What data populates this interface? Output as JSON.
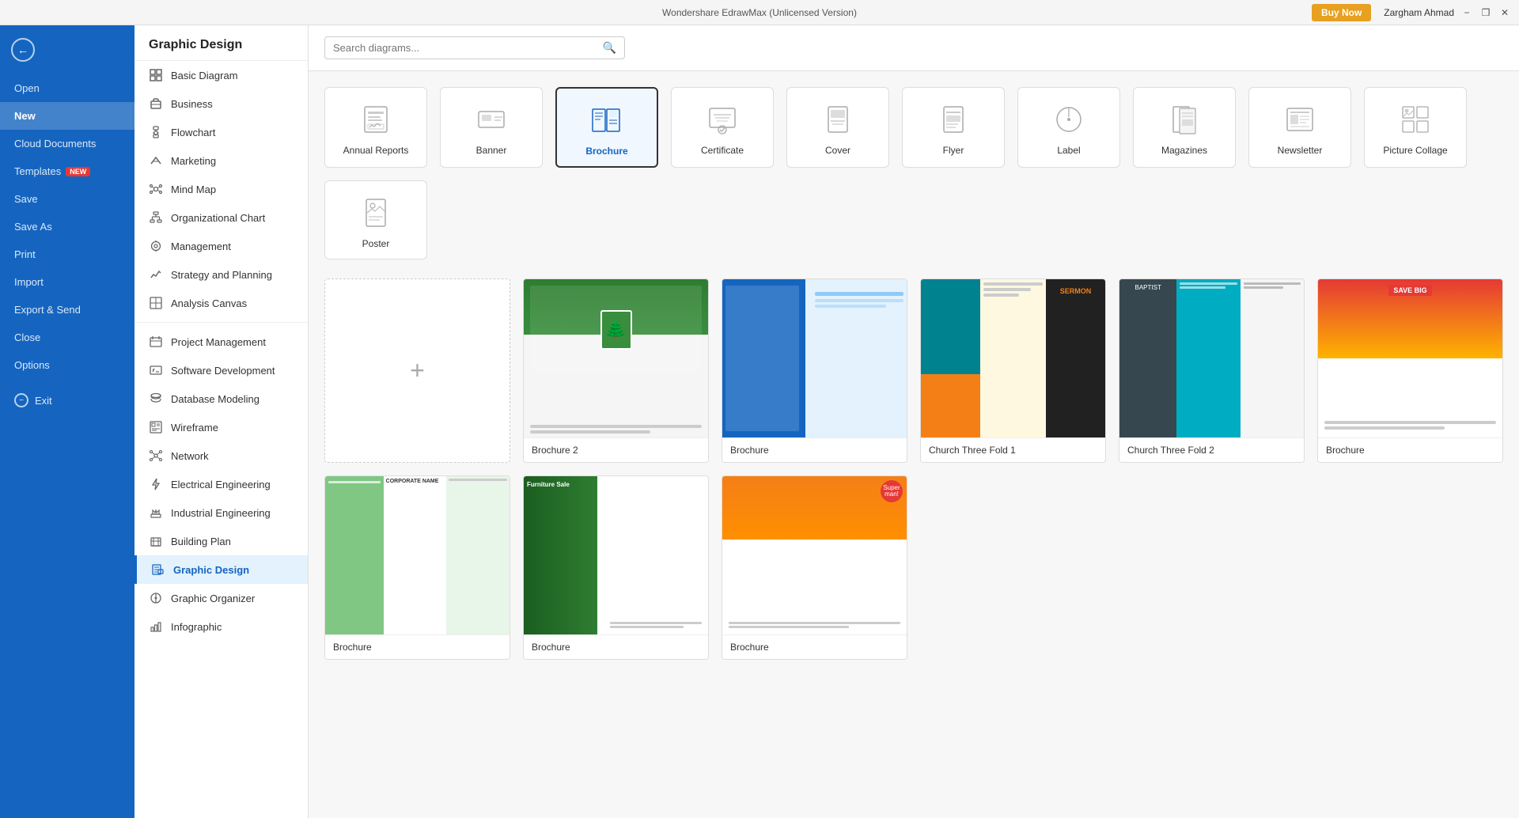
{
  "titlebar": {
    "title": "Wondershare EdrawMax (Unlicensed Version)",
    "controls": [
      "minimize",
      "restore",
      "close"
    ],
    "buy_now": "Buy Now",
    "user": "Zargham Ahmad"
  },
  "sidebar": {
    "back_label": "←",
    "items": [
      {
        "id": "open",
        "label": "Open",
        "active": false
      },
      {
        "id": "new",
        "label": "New",
        "active": true
      },
      {
        "id": "cloud",
        "label": "Cloud Documents",
        "active": false
      },
      {
        "id": "templates",
        "label": "Templates",
        "badge": "NEW",
        "active": false
      },
      {
        "id": "save",
        "label": "Save",
        "active": false
      },
      {
        "id": "save-as",
        "label": "Save As",
        "active": false
      },
      {
        "id": "print",
        "label": "Print",
        "active": false
      },
      {
        "id": "import",
        "label": "Import",
        "active": false
      },
      {
        "id": "export",
        "label": "Export & Send",
        "active": false
      },
      {
        "id": "close",
        "label": "Close",
        "active": false
      },
      {
        "id": "options",
        "label": "Options",
        "active": false
      },
      {
        "id": "exit",
        "label": "Exit",
        "active": false
      }
    ]
  },
  "categories_panel": {
    "header": "Graphic Design",
    "items": [
      {
        "id": "basic",
        "label": "Basic Diagram",
        "icon": "grid"
      },
      {
        "id": "business",
        "label": "Business",
        "icon": "briefcase"
      },
      {
        "id": "flowchart",
        "label": "Flowchart",
        "icon": "flow"
      },
      {
        "id": "marketing",
        "label": "Marketing",
        "icon": "marketing"
      },
      {
        "id": "mindmap",
        "label": "Mind Map",
        "icon": "mindmap"
      },
      {
        "id": "orgchart",
        "label": "Organizational Chart",
        "icon": "org"
      },
      {
        "id": "management",
        "label": "Management",
        "icon": "mgmt"
      },
      {
        "id": "strategy",
        "label": "Strategy and Planning",
        "icon": "strategy"
      },
      {
        "id": "analysis",
        "label": "Analysis Canvas",
        "icon": "analysis"
      },
      {
        "id": "project",
        "label": "Project Management",
        "icon": "project"
      },
      {
        "id": "software",
        "label": "Software Development",
        "icon": "software"
      },
      {
        "id": "database",
        "label": "Database Modeling",
        "icon": "database"
      },
      {
        "id": "wireframe",
        "label": "Wireframe",
        "icon": "wireframe"
      },
      {
        "id": "network",
        "label": "Network",
        "icon": "network"
      },
      {
        "id": "electrical",
        "label": "Electrical Engineering",
        "icon": "electrical"
      },
      {
        "id": "industrial",
        "label": "Industrial Engineering",
        "icon": "industrial"
      },
      {
        "id": "building",
        "label": "Building Plan",
        "icon": "building"
      },
      {
        "id": "graphic",
        "label": "Graphic Design",
        "icon": "graphic",
        "active": true
      },
      {
        "id": "organizer",
        "label": "Graphic Organizer",
        "icon": "organizer"
      },
      {
        "id": "infographic",
        "label": "Infographic",
        "icon": "infographic"
      }
    ]
  },
  "search": {
    "placeholder": "Search diagrams..."
  },
  "main": {
    "category_tiles": [
      {
        "id": "annual",
        "label": "Annual Reports",
        "selected": false
      },
      {
        "id": "banner",
        "label": "Banner",
        "selected": false
      },
      {
        "id": "brochure",
        "label": "Brochure",
        "selected": true
      },
      {
        "id": "certificate",
        "label": "Certificate",
        "selected": false
      },
      {
        "id": "cover",
        "label": "Cover",
        "selected": false
      },
      {
        "id": "flyer",
        "label": "Flyer",
        "selected": false
      },
      {
        "id": "label",
        "label": "Label",
        "selected": false
      },
      {
        "id": "magazines",
        "label": "Magazines",
        "selected": false
      },
      {
        "id": "newsletter",
        "label": "Newsletter",
        "selected": false
      },
      {
        "id": "picture-collage",
        "label": "Picture Collage",
        "selected": false
      },
      {
        "id": "poster",
        "label": "Poster",
        "selected": false
      }
    ],
    "add_new_label": "+",
    "templates": [
      {
        "id": "brochure-2",
        "label": "Brochure 2",
        "color": "brochure-1"
      },
      {
        "id": "brochure",
        "label": "Brochure",
        "color": "brochure-2"
      },
      {
        "id": "church-three-fold-1",
        "label": "Church Three Fold 1",
        "color": "brochure-3"
      },
      {
        "id": "church-three-fold-2",
        "label": "Church Three Fold 2",
        "color": "brochure-4"
      },
      {
        "id": "brochure-row2-1",
        "label": "Brochure",
        "color": "brochure-5"
      },
      {
        "id": "brochure-row2-2",
        "label": "Brochure",
        "color": "brochure-6"
      },
      {
        "id": "brochure-row2-3",
        "label": "Brochure",
        "color": "brochure-1"
      },
      {
        "id": "brochure-row2-4",
        "label": "Brochure",
        "color": "brochure-2"
      }
    ]
  }
}
